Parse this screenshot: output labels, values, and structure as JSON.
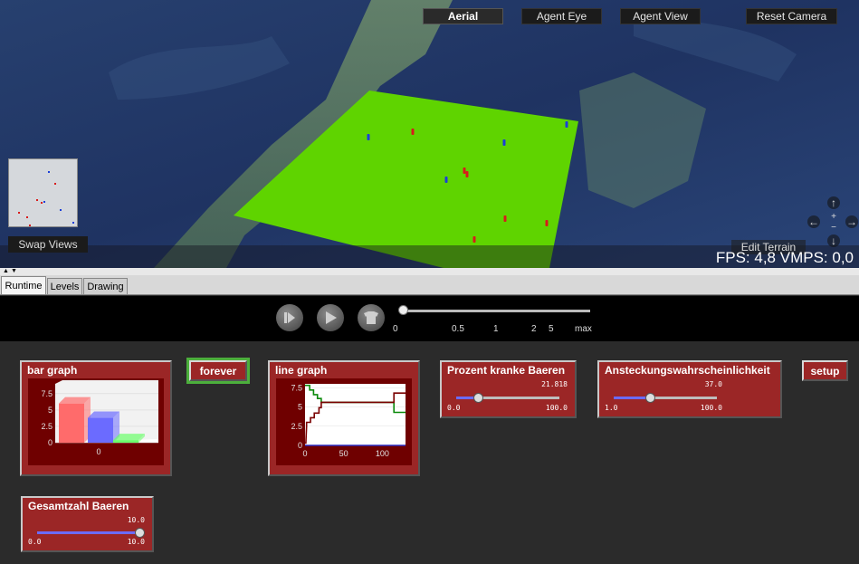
{
  "viewport": {
    "view_buttons": [
      {
        "label": "Aerial",
        "active": true
      },
      {
        "label": "Agent Eye",
        "active": false
      },
      {
        "label": "Agent View",
        "active": false
      }
    ],
    "reset_camera": "Reset Camera",
    "swap_views": "Swap Views",
    "edit_terrain": "Edit Terrain",
    "fps": "FPS: 4,8  VMPS: 0,0",
    "ground_color": "#5fd400",
    "agent_colors": {
      "sick": "#d81b1b",
      "healthy": "#1c3fd8"
    },
    "nav_icons": [
      "arrow-up-icon",
      "arrow-left-icon",
      "zoom-plus-icon",
      "zoom-minus-icon",
      "arrow-right-icon",
      "arrow-down-icon"
    ]
  },
  "tabs": [
    {
      "label": "Runtime",
      "active": true
    },
    {
      "label": "Levels",
      "active": false
    },
    {
      "label": "Drawing",
      "active": false
    }
  ],
  "controls": {
    "icons": [
      "step-icon",
      "play-icon",
      "stop-icon"
    ],
    "speed_ticks": [
      "0",
      "0.5",
      "1",
      "2",
      "5",
      "max"
    ],
    "speed_value": 0
  },
  "widgets": {
    "bar_graph": {
      "title": "bar graph",
      "chart_data": {
        "type": "bar",
        "categories": [
          "0"
        ],
        "series": [
          {
            "values": [
              6
            ],
            "color": "#ff6b6b"
          },
          {
            "values": [
              3.8
            ],
            "color": "#6b6bff"
          },
          {
            "values": [
              0.4
            ],
            "color": "#6bff6b"
          }
        ],
        "y_ticks": [
          "7.5",
          "5",
          "2.5",
          "0"
        ],
        "ylim": [
          0,
          9
        ]
      }
    },
    "forever_button": "forever",
    "line_graph": {
      "title": "line graph",
      "chart_data": {
        "type": "line",
        "x_ticks": [
          "0",
          "50",
          "100"
        ],
        "y_ticks": [
          "7.5",
          "5",
          "2.5",
          "0"
        ],
        "xlim": [
          0,
          130
        ],
        "ylim": [
          0,
          8
        ],
        "series": [
          {
            "color": "#0a8a0a",
            "x": [
              0,
              1,
              6,
              6,
              11,
              11,
              16,
              16,
              21,
              21,
              115,
              115,
              130
            ],
            "y": [
              7.8,
              7.8,
              7.8,
              7.2,
              7.2,
              6.6,
              6.6,
              6.1,
              6.1,
              5.6,
              5.6,
              4.3,
              4.3
            ]
          },
          {
            "color": "#7a0000",
            "x": [
              0,
              1,
              2,
              2,
              7,
              7,
              12,
              12,
              18,
              18,
              21,
              21,
              115,
              115,
              130
            ],
            "y": [
              0.3,
              0.3,
              2.5,
              3.0,
              3.0,
              3.6,
              3.6,
              4.2,
              4.2,
              4.9,
              4.9,
              5.6,
              5.6,
              6.8,
              6.8
            ]
          }
        ]
      }
    },
    "prozent_slider": {
      "title": "Prozent kranke Baeren",
      "value": "21.818",
      "min": "0.0",
      "max": "100.0",
      "fraction": 0.218
    },
    "ansteckung_slider": {
      "title": "Ansteckungswahrscheinlichkeit",
      "value": "37.0",
      "min": "1.0",
      "max": "100.0",
      "fraction": 0.364
    },
    "setup_button": "setup",
    "gesamtzahl_slider": {
      "title": "Gesamtzahl Baeren",
      "value": "10.0",
      "min": "0.0",
      "max": "10.0",
      "fraction": 1.0
    }
  }
}
